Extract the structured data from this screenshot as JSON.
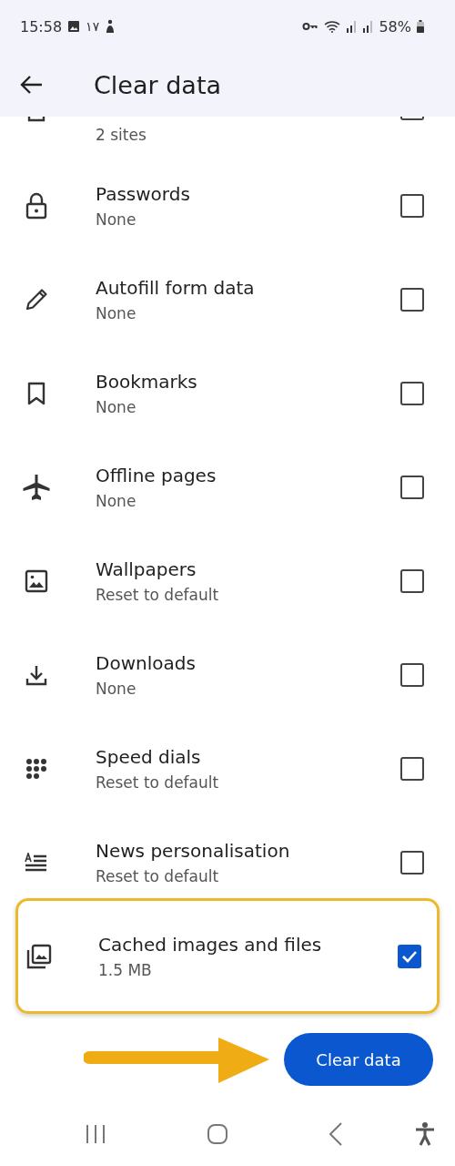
{
  "status_bar": {
    "time": "15:58",
    "notification_text": "١٧",
    "battery": "58%"
  },
  "header": {
    "title": "Clear data"
  },
  "partial_item": {
    "subtitle": "2 sites",
    "checked": false
  },
  "items": [
    {
      "kind": "lock",
      "title": "Passwords",
      "subtitle": "None",
      "checked": false,
      "highlighted": false
    },
    {
      "kind": "pencil",
      "title": "Autofill form data",
      "subtitle": "None",
      "checked": false,
      "highlighted": false
    },
    {
      "kind": "bookmark",
      "title": "Bookmarks",
      "subtitle": "None",
      "checked": false,
      "highlighted": false
    },
    {
      "kind": "plane",
      "title": "Offline pages",
      "subtitle": "None",
      "checked": false,
      "highlighted": false
    },
    {
      "kind": "image",
      "title": "Wallpapers",
      "subtitle": "Reset to default",
      "checked": false,
      "highlighted": false
    },
    {
      "kind": "download",
      "title": "Downloads",
      "subtitle": "None",
      "checked": false,
      "highlighted": false
    },
    {
      "kind": "dots",
      "title": "Speed dials",
      "subtitle": "Reset to default",
      "checked": false,
      "highlighted": false
    },
    {
      "kind": "news",
      "title": "News personalisation",
      "subtitle": "Reset to default",
      "checked": false,
      "highlighted": false
    },
    {
      "kind": "images",
      "title": "Cached images and files",
      "subtitle": "1.5 MB",
      "checked": true,
      "highlighted": true
    }
  ],
  "action": {
    "label": "Clear data"
  }
}
